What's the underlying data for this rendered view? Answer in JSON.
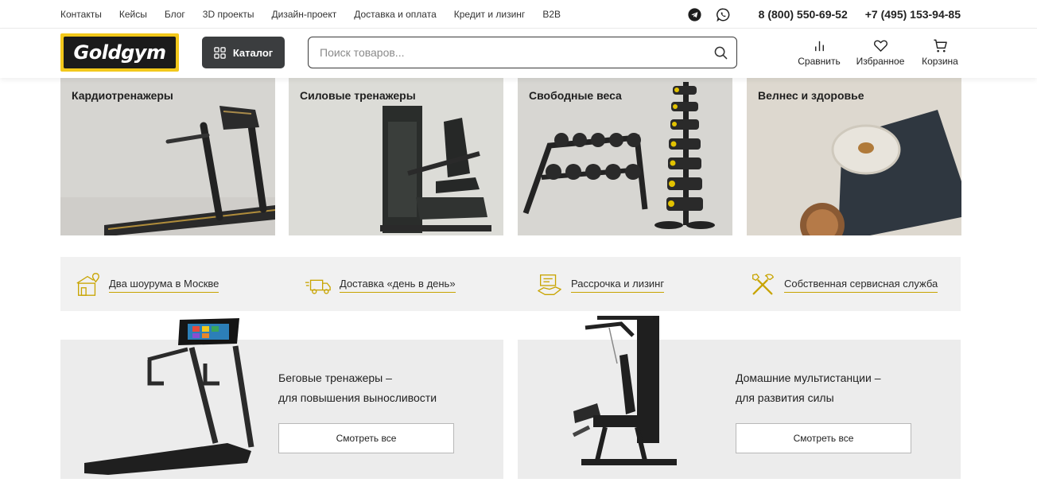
{
  "topnav": {
    "links": [
      "Контакты",
      "Кейсы",
      "Блог",
      "3D проекты",
      "Дизайн-проект",
      "Доставка и оплата",
      "Кредит и лизинг",
      "B2B"
    ],
    "phone1": "8 (800) 550-69-52",
    "phone2": "+7 (495) 153-94-85",
    "social": [
      "telegram-icon",
      "whatsapp-icon"
    ]
  },
  "header": {
    "logo_text": "Goldgym",
    "catalog_label": "Каталог",
    "search_placeholder": "Поиск товаров...",
    "compare_label": "Сравнить",
    "favorites_label": "Избранное",
    "cart_label": "Корзина"
  },
  "categories": [
    {
      "title": "Кардиотренажеры"
    },
    {
      "title": "Силовые тренажеры"
    },
    {
      "title": "Свободные веса"
    },
    {
      "title": "Велнес и здоровье"
    }
  ],
  "benefits": [
    {
      "label": "Два шоурума в Москве",
      "icon": "showroom-icon"
    },
    {
      "label": "Доставка «день в день»",
      "icon": "delivery-truck-icon"
    },
    {
      "label": "Рассрочка и лизинг",
      "icon": "installment-icon"
    },
    {
      "label": "Собственная сервисная служба",
      "icon": "service-tools-icon"
    }
  ],
  "promos": [
    {
      "line1": "Беговые тренажеры –",
      "line2": "для повышения выносливости",
      "button": "Смотреть все"
    },
    {
      "line1": "Домашние мультистанции –",
      "line2": "для развития силы",
      "button": "Смотреть все"
    }
  ],
  "colors": {
    "accent": "#f2c81b",
    "dark": "#3b3d3f",
    "benefit_icon": "#c8a400"
  }
}
